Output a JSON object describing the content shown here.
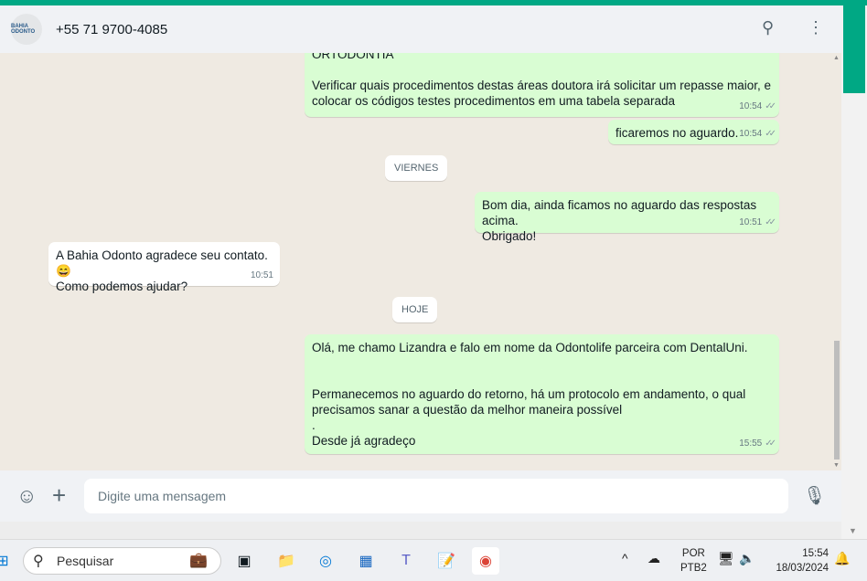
{
  "header": {
    "contact": "+55 71 9700-4085",
    "avatar_text": "BAHIA ODONTO"
  },
  "messages": [
    {
      "dir": "out",
      "text_lines": [
        "ORTODONTIA",
        "",
        "Verificar quais procedimentos destas áreas doutora irá solicitar um repasse maior, e",
        "colocar os códigos testes procedimentos em uma tabela separada"
      ],
      "time": "10:54"
    },
    {
      "dir": "out",
      "text": "ficaremos no aguardo.",
      "time": "10:54"
    },
    {
      "dir": "out",
      "text_lines": [
        "Bom dia, ainda ficamos no aguardo das respostas acima.",
        "Obrigado!"
      ],
      "time": "10:51"
    },
    {
      "dir": "in",
      "text_lines": [
        "A Bahia Odonto agradece seu contato. 😄",
        "Como podemos ajudar?"
      ],
      "time": "10:51"
    },
    {
      "dir": "out",
      "text_lines": [
        "Olá, me chamo Lizandra e falo em nome da Odontolife parceira com DentalUni.",
        "",
        "",
        "Permanecemos no aguardo do retorno, há um protocolo em andamento, o qual",
        "precisamos sanar a questão da melhor maneira possível",
        ".",
        "Desde já agradeço"
      ],
      "time": "15:55"
    }
  ],
  "dividers": {
    "friday": "VIERNES",
    "today": "HOJE"
  },
  "footer": {
    "placeholder": "Digite uma mensagem"
  },
  "taskbar": {
    "search": "Pesquisar",
    "lang1": "POR",
    "lang2": "PTB2",
    "time": "15:54",
    "date": "18/03/2024"
  }
}
